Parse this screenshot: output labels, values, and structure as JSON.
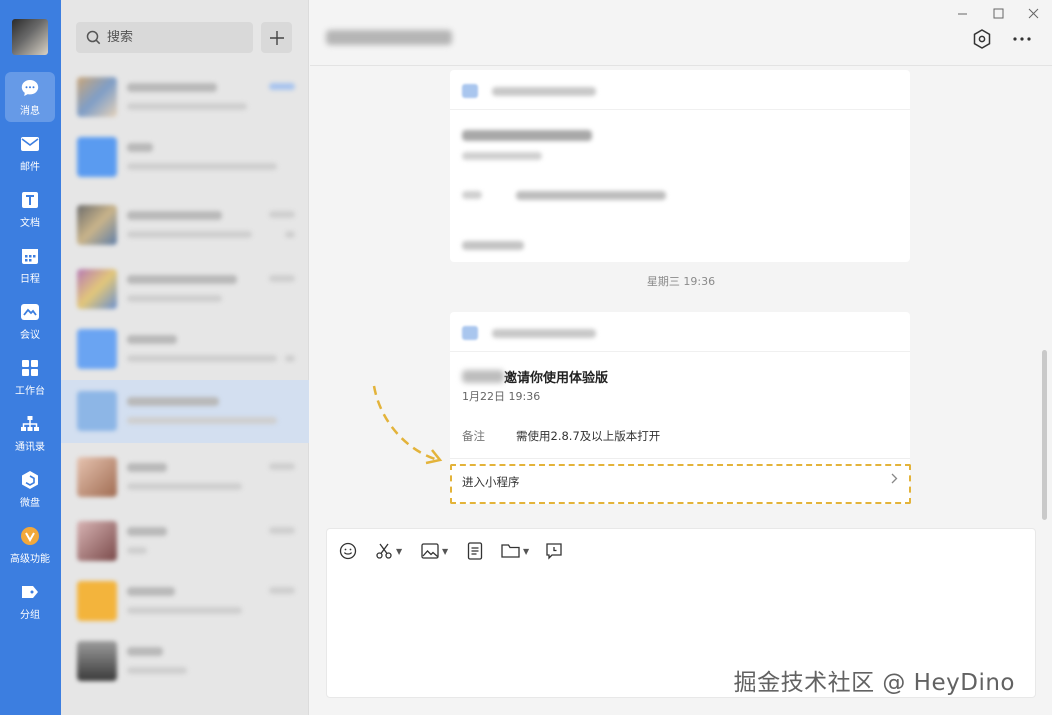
{
  "nav": {
    "items": [
      {
        "label": "消息",
        "icon": "message-bubble-icon"
      },
      {
        "label": "邮件",
        "icon": "mail-icon"
      },
      {
        "label": "文档",
        "icon": "document-icon"
      },
      {
        "label": "日程",
        "icon": "calendar-icon"
      },
      {
        "label": "会议",
        "icon": "meeting-icon"
      },
      {
        "label": "工作台",
        "icon": "workbench-grid-icon"
      },
      {
        "label": "通讯录",
        "icon": "contacts-tree-icon"
      },
      {
        "label": "微盘",
        "icon": "drive-icon"
      },
      {
        "label": "高级功能",
        "icon": "premium-v-icon"
      },
      {
        "label": "分组",
        "icon": "tag-icon"
      }
    ]
  },
  "search": {
    "placeholder": "搜索"
  },
  "chat": {
    "timestamp": "星期三 19:36",
    "card": {
      "title_suffix": "邀请你使用体验版",
      "date": "1月22日 19:36",
      "note_label": "备注",
      "note_value": "需使用2.8.7及以上版本打开",
      "enter_label": "进入小程序"
    }
  },
  "watermark": "掘金技术社区 @ HeyDino",
  "colors": {
    "rail": "#3c7ee0",
    "highlight": "#e3b33a"
  }
}
